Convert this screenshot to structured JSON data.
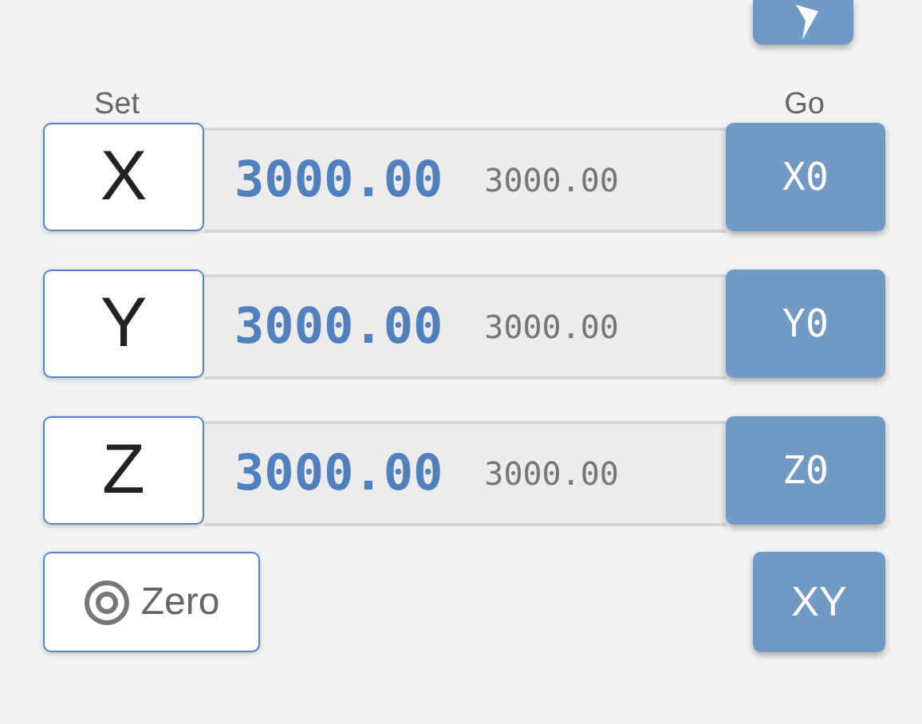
{
  "top_button": {
    "kind": "icon"
  },
  "headers": {
    "set": "Set",
    "go": "Go"
  },
  "axes": [
    {
      "set_label": "X",
      "work": "3000.00",
      "machine": "3000.00",
      "go_label": "X0"
    },
    {
      "set_label": "Y",
      "work": "3000.00",
      "machine": "3000.00",
      "go_label": "Y0"
    },
    {
      "set_label": "Z",
      "work": "3000.00",
      "machine": "3000.00",
      "go_label": "Z0"
    }
  ],
  "zero_button": {
    "label": "Zero"
  },
  "xy_button": {
    "label": "XY"
  }
}
